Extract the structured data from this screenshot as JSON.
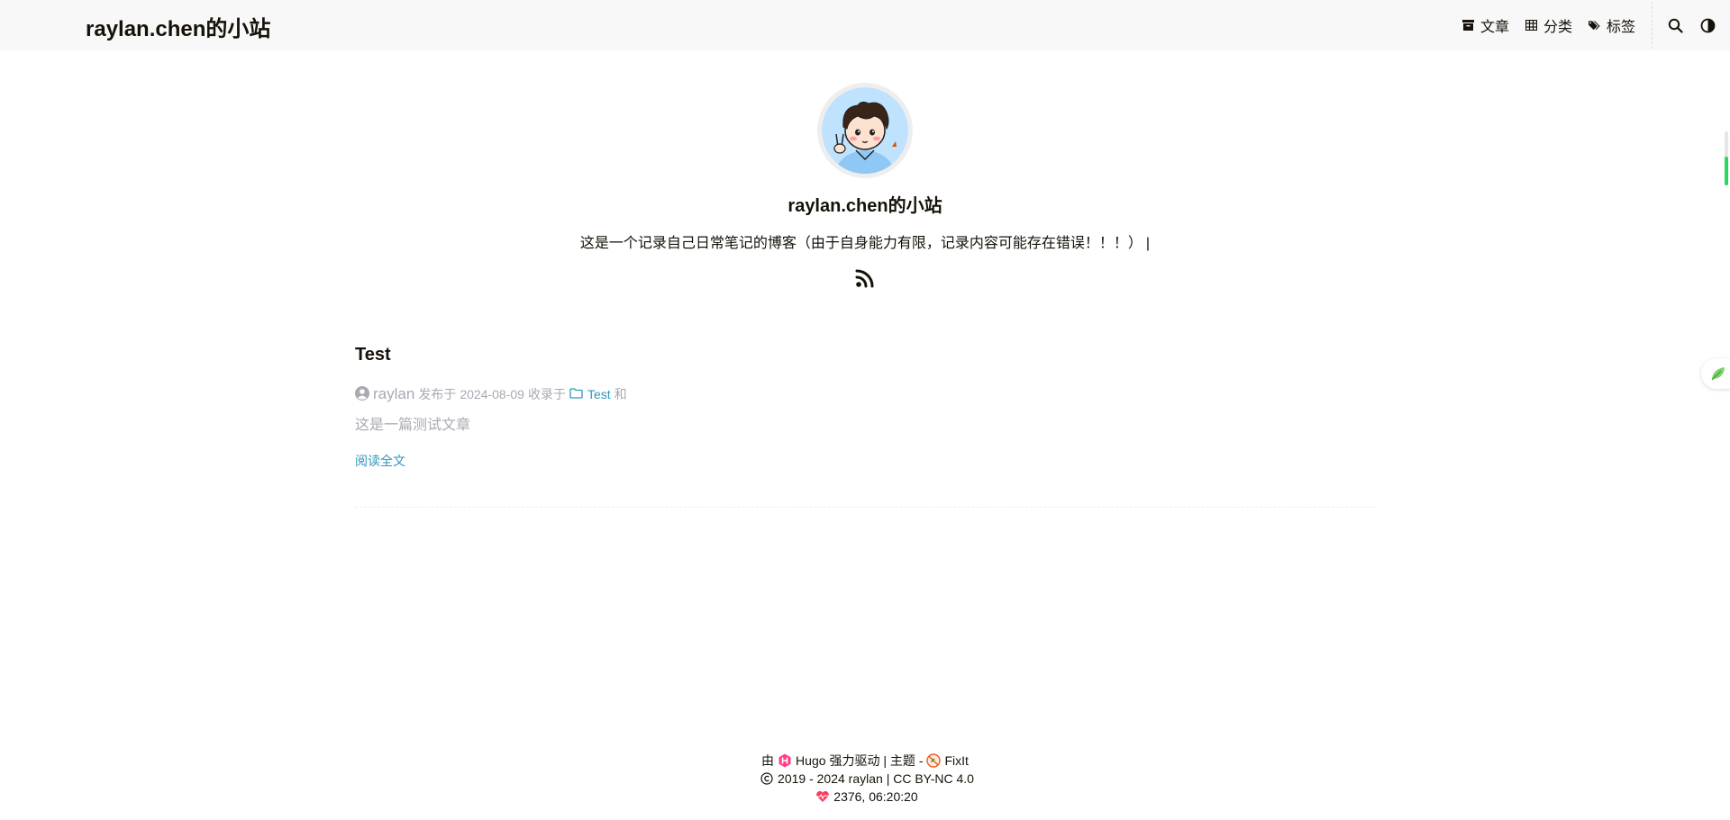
{
  "header": {
    "site_title": "raylan.chen的小站",
    "nav": [
      {
        "label": "文章",
        "icon": "archive-icon"
      },
      {
        "label": "分类",
        "icon": "grid-icon"
      },
      {
        "label": "标签",
        "icon": "tags-icon"
      }
    ],
    "search_icon": "search-icon",
    "theme_icon": "theme-toggle-icon"
  },
  "profile": {
    "name": "raylan.chen的小站",
    "subtitle": "这是一个记录自己日常笔记的博客（由于自身能力有限，记录内容可能存在错误！！！）",
    "cursor": "|",
    "rss_icon": "rss-icon"
  },
  "post": {
    "title": "Test",
    "author": "raylan",
    "published_prefix": "发布于",
    "date": "2024-08-09",
    "category_prefix": "收录于",
    "category": "Test",
    "category_suffix": "和",
    "summary": "这是一篇测试文章",
    "read_more": "阅读全文"
  },
  "footer": {
    "powered_prefix": "由",
    "hugo": "Hugo",
    "powered_suffix": "强力驱动 | 主题 -",
    "theme": "FixIt",
    "copyright": "2019 - 2024 raylan | CC BY-NC 4.0",
    "runtime": "2376, 06:20:20"
  },
  "colors": {
    "accent": "#2d96bd",
    "muted": "#a9a9b3",
    "header_bg": "#f8f8f8",
    "hugo_pink": "#ff4088",
    "heart_red": "#ff3860",
    "scroll_green": "#2bd665"
  }
}
